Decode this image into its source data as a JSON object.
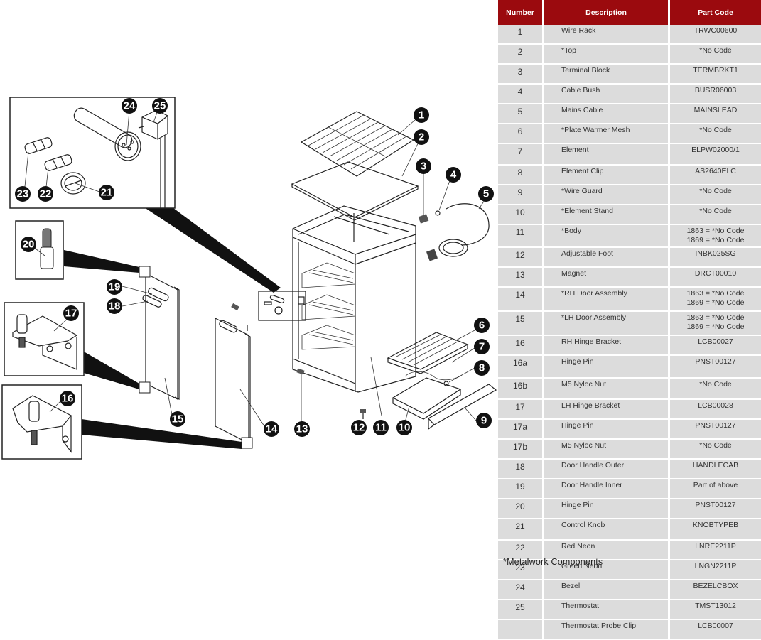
{
  "table": {
    "headers": {
      "number": "Number",
      "description": "Description",
      "part_code": "Part Code"
    },
    "rows": [
      {
        "number": "1",
        "description": "Wire Rack",
        "code": [
          "TRWC00600"
        ]
      },
      {
        "number": "2",
        "description": "*Top",
        "code": [
          "*No Code"
        ]
      },
      {
        "number": "3",
        "description": "Terminal Block",
        "code": [
          "TERMBRKT1"
        ]
      },
      {
        "number": "4",
        "description": "Cable Bush",
        "code": [
          "BUSR06003"
        ]
      },
      {
        "number": "5",
        "description": "Mains Cable",
        "code": [
          "MAINSLEAD"
        ]
      },
      {
        "number": "6",
        "description": "*Plate Warmer Mesh",
        "code": [
          "*No Code"
        ]
      },
      {
        "number": "7",
        "description": "Element",
        "code": [
          "ELPW02000/1"
        ]
      },
      {
        "number": "8",
        "description": "Element Clip",
        "code": [
          "AS2640ELC"
        ]
      },
      {
        "number": "9",
        "description": "*Wire Guard",
        "code": [
          "*No Code"
        ]
      },
      {
        "number": "10",
        "description": "*Element Stand",
        "code": [
          "*No Code"
        ]
      },
      {
        "number": "11",
        "description": "*Body",
        "code": [
          "1863 = *No Code",
          "1869 = *No Code"
        ]
      },
      {
        "number": "12",
        "description": "Adjustable Foot",
        "code": [
          "INBK025SG"
        ]
      },
      {
        "number": "13",
        "description": "Magnet",
        "code": [
          "DRCT00010"
        ]
      },
      {
        "number": "14",
        "description": "*RH Door Assembly",
        "code": [
          "1863 = *No Code",
          "1869 = *No Code"
        ]
      },
      {
        "number": "15",
        "description": "*LH Door Assembly",
        "code": [
          "1863 = *No Code",
          "1869 = *No Code"
        ]
      },
      {
        "number": "16",
        "description": "RH Hinge Bracket",
        "code": [
          "LCB00027"
        ]
      },
      {
        "number": "16a",
        "description": "Hinge Pin",
        "code": [
          "PNST00127"
        ]
      },
      {
        "number": "16b",
        "description": "M5 Nyloc Nut",
        "code": [
          "*No Code"
        ]
      },
      {
        "number": "17",
        "description": "LH Hinge Bracket",
        "code": [
          "LCB00028"
        ]
      },
      {
        "number": "17a",
        "description": "Hinge Pin",
        "code": [
          "PNST00127"
        ]
      },
      {
        "number": "17b",
        "description": "M5 Nyloc Nut",
        "code": [
          "*No Code"
        ]
      },
      {
        "number": "18",
        "description": "Door Handle Outer",
        "code": [
          "HANDLECAB"
        ]
      },
      {
        "number": "19",
        "description": "Door Handle Inner",
        "code": [
          "Part of above"
        ]
      },
      {
        "number": "20",
        "description": "Hinge Pin",
        "code": [
          "PNST00127"
        ]
      },
      {
        "number": "21",
        "description": "Control Knob",
        "code": [
          "KNOBTYPEB"
        ]
      },
      {
        "number": "22",
        "description": "Red Neon",
        "code": [
          "LNRE2211P"
        ]
      },
      {
        "number": "23",
        "description": "Green Neon",
        "code": [
          "LNGN2211P"
        ]
      },
      {
        "number": "24",
        "description": "Bezel",
        "code": [
          "BEZELCBOX"
        ]
      },
      {
        "number": "25",
        "description": "Thermostat",
        "code": [
          "TMST13012"
        ]
      },
      {
        "number": "",
        "description": "Thermostat Probe Clip",
        "code": [
          "LCB00007"
        ]
      }
    ]
  },
  "footnote": "*Metalwork Components",
  "diagram": {
    "callouts": [
      "1",
      "2",
      "3",
      "4",
      "5",
      "6",
      "7",
      "8",
      "9",
      "10",
      "11",
      "12",
      "13",
      "14",
      "15",
      "16",
      "17",
      "18",
      "19",
      "20",
      "21",
      "22",
      "23",
      "24",
      "25"
    ]
  },
  "colors": {
    "header": "#9b0a0e",
    "row": "#dcdcdc",
    "callout": "#111111"
  }
}
